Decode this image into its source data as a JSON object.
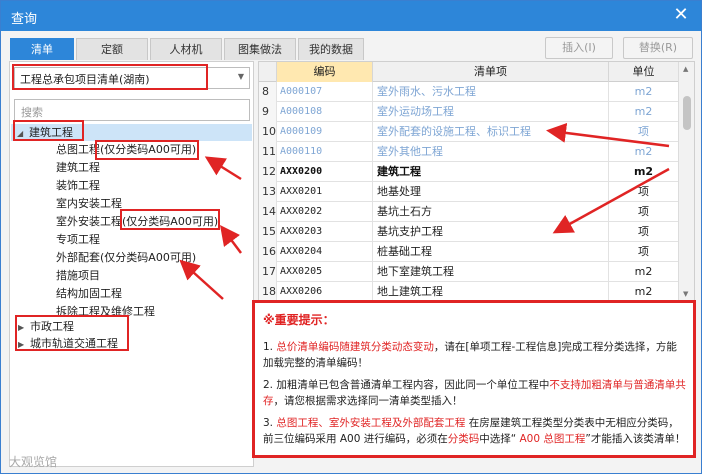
{
  "window": {
    "title": "查询",
    "close_glyph": "✕"
  },
  "tabs": [
    "清单",
    "定额",
    "人材机",
    "图集做法",
    "我的数据"
  ],
  "buttons": {
    "insert": "插入(I)",
    "replace": "替换(R)"
  },
  "selector": {
    "value": "工程总承包项目清单(湖南)"
  },
  "search": {
    "placeholder": "搜索"
  },
  "tree": [
    {
      "label": "建筑工程",
      "expanded": true,
      "level": 0
    },
    {
      "label": "总图工程",
      "note": "(仅分类码A00可用)",
      "level": 1
    },
    {
      "label": "建筑工程",
      "level": 1
    },
    {
      "label": "装饰工程",
      "level": 1
    },
    {
      "label": "室内安装工程",
      "level": 1
    },
    {
      "label": "室外安装工程",
      "note": "(仅分类码A00可用)",
      "level": 1
    },
    {
      "label": "专项工程",
      "level": 1
    },
    {
      "label": "外部配套",
      "note": "(仅分类码A00可用)",
      "level": 1
    },
    {
      "label": "措施项目",
      "level": 1
    },
    {
      "label": "结构加固工程",
      "level": 1
    },
    {
      "label": "拆除工程及维修工程",
      "level": 1
    },
    {
      "label": "市政工程",
      "expanded": false,
      "level": 0
    },
    {
      "label": "城市轨道交通工程",
      "expanded": false,
      "level": 0
    }
  ],
  "grid": {
    "headers": [
      "",
      "编码",
      "清单项",
      "单位"
    ],
    "rows": [
      {
        "num": "8",
        "code": "A000107",
        "name": "室外雨水、污水工程",
        "unit": "m2",
        "style": "muted"
      },
      {
        "num": "9",
        "code": "A000108",
        "name": "室外运动场工程",
        "unit": "m2",
        "style": "muted"
      },
      {
        "num": "10",
        "code": "A000109",
        "name": "室外配套的设施工程、标识工程",
        "unit": "项",
        "style": "muted"
      },
      {
        "num": "11",
        "code": "A000110",
        "name": "室外其他工程",
        "unit": "m2",
        "style": "muted"
      },
      {
        "num": "12",
        "code": "AXX0200",
        "name": "建筑工程",
        "unit": "m2",
        "style": "bold"
      },
      {
        "num": "13",
        "code": "AXX0201",
        "name": "地基处理",
        "unit": "项",
        "style": "normal"
      },
      {
        "num": "14",
        "code": "AXX0202",
        "name": "基坑土石方",
        "unit": "项",
        "style": "normal"
      },
      {
        "num": "15",
        "code": "AXX0203",
        "name": "基坑支护工程",
        "unit": "项",
        "style": "normal"
      },
      {
        "num": "16",
        "code": "AXX0204",
        "name": "桩基础工程",
        "unit": "项",
        "style": "normal"
      },
      {
        "num": "17",
        "code": "AXX0205",
        "name": "地下室建筑工程",
        "unit": "m2",
        "style": "normal"
      },
      {
        "num": "18",
        "code": "AXX0206",
        "name": "地上建筑工程",
        "unit": "m2",
        "style": "normal"
      }
    ]
  },
  "tips": {
    "title": "※重要提示：",
    "item1": {
      "prefix": "1. ",
      "red": "总价清单编码随建筑分类动态变动",
      "rest": "，请在[单项工程-工程信息]完成工程分类选择，方能加载完整的清单编码！"
    },
    "item2": {
      "prefix": "2. 加粗清单已包含普通清单工程内容，因此同一个单位工程中",
      "red": "不支持加粗清单与普通清单共存",
      "rest": "，请您根据需求选择同一清单类型插入！"
    },
    "item3": {
      "prefix": "3. ",
      "red": "总图工程、室外安装工程及外部配套工程",
      "mid": " 在房屋建筑工程类型分类表中无相应分类码，前三位编码采用 A00 进行编码，必须在",
      "red2": "分类码",
      "mid2": "中选择“ ",
      "red3": "A00 总图工程",
      "rest": "”才能插入该类清单！"
    }
  },
  "watermark": "大观览馆",
  "colors": {
    "accent": "#2d86d9",
    "annotation_red": "#e02424",
    "muted_text": "#7fa6d4",
    "selected_row": "#cde4f8"
  }
}
